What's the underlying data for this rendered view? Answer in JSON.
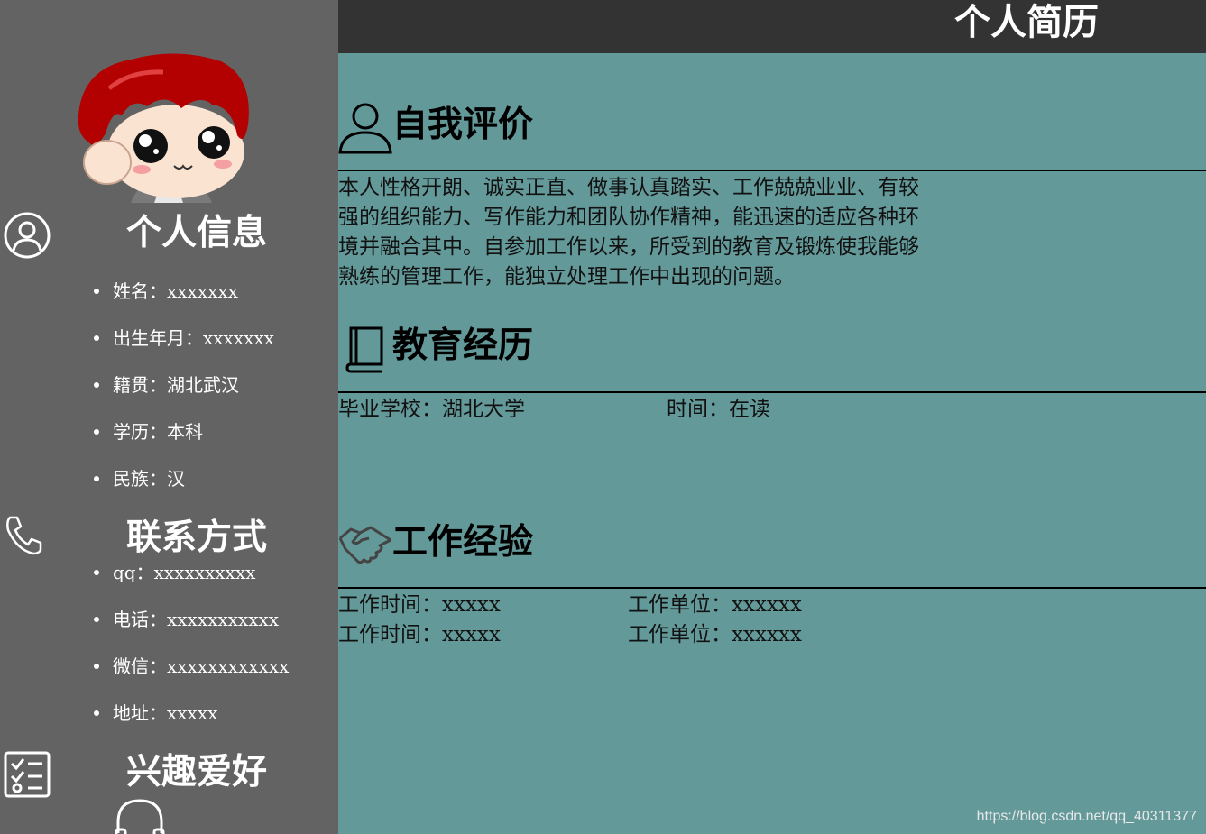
{
  "header": {
    "title": "个人简历"
  },
  "sidebar": {
    "personal_info": {
      "heading": "个人信息",
      "icon": "user-circle-icon",
      "items": [
        "姓名：xxxxxxx",
        "出生年月：xxxxxxx",
        "籍贯：湖北武汉",
        "学历：本科",
        "民族：汉"
      ]
    },
    "contact": {
      "heading": "联系方式",
      "icon": "phone-icon",
      "items": [
        "qq：xxxxxxxxxx",
        "电话：xxxxxxxxxxx",
        "微信：xxxxxxxxxxxx",
        "地址：xxxxx"
      ]
    },
    "hobbies": {
      "heading": "兴趣爱好",
      "icon": "checklist-icon",
      "first_icon": "headphones-icon"
    }
  },
  "main": {
    "self_eval": {
      "title": "自我评价",
      "icon": "person-outline-icon",
      "text": "本人性格开朗、诚实正直、做事认真踏实、工作兢兢业业、有较强的组织能力、写作能力和团队协作精神，能迅速的适应各种环境并融合其中。自参加工作以来，所受到的教育及锻炼使我能够熟练的管理工作，能独立处理工作中出现的问题。"
    },
    "education": {
      "title": "教育经历",
      "icon": "book-icon",
      "school": "毕业学校：湖北大学",
      "time": "时间：在读"
    },
    "work": {
      "title": "工作经验",
      "icon": "handshake-icon",
      "rows": [
        {
          "time": "工作时间：xxxxx",
          "unit": "工作单位：xxxxxx"
        },
        {
          "time": "工作时间：xxxxx",
          "unit": "工作单位：xxxxxx"
        }
      ]
    }
  },
  "watermark": "https://blog.csdn.net/qq_40311377",
  "colors": {
    "sidebar": "#636363",
    "topbar": "#333333",
    "main": "#64999a",
    "avatar_hair": "#b30000"
  }
}
